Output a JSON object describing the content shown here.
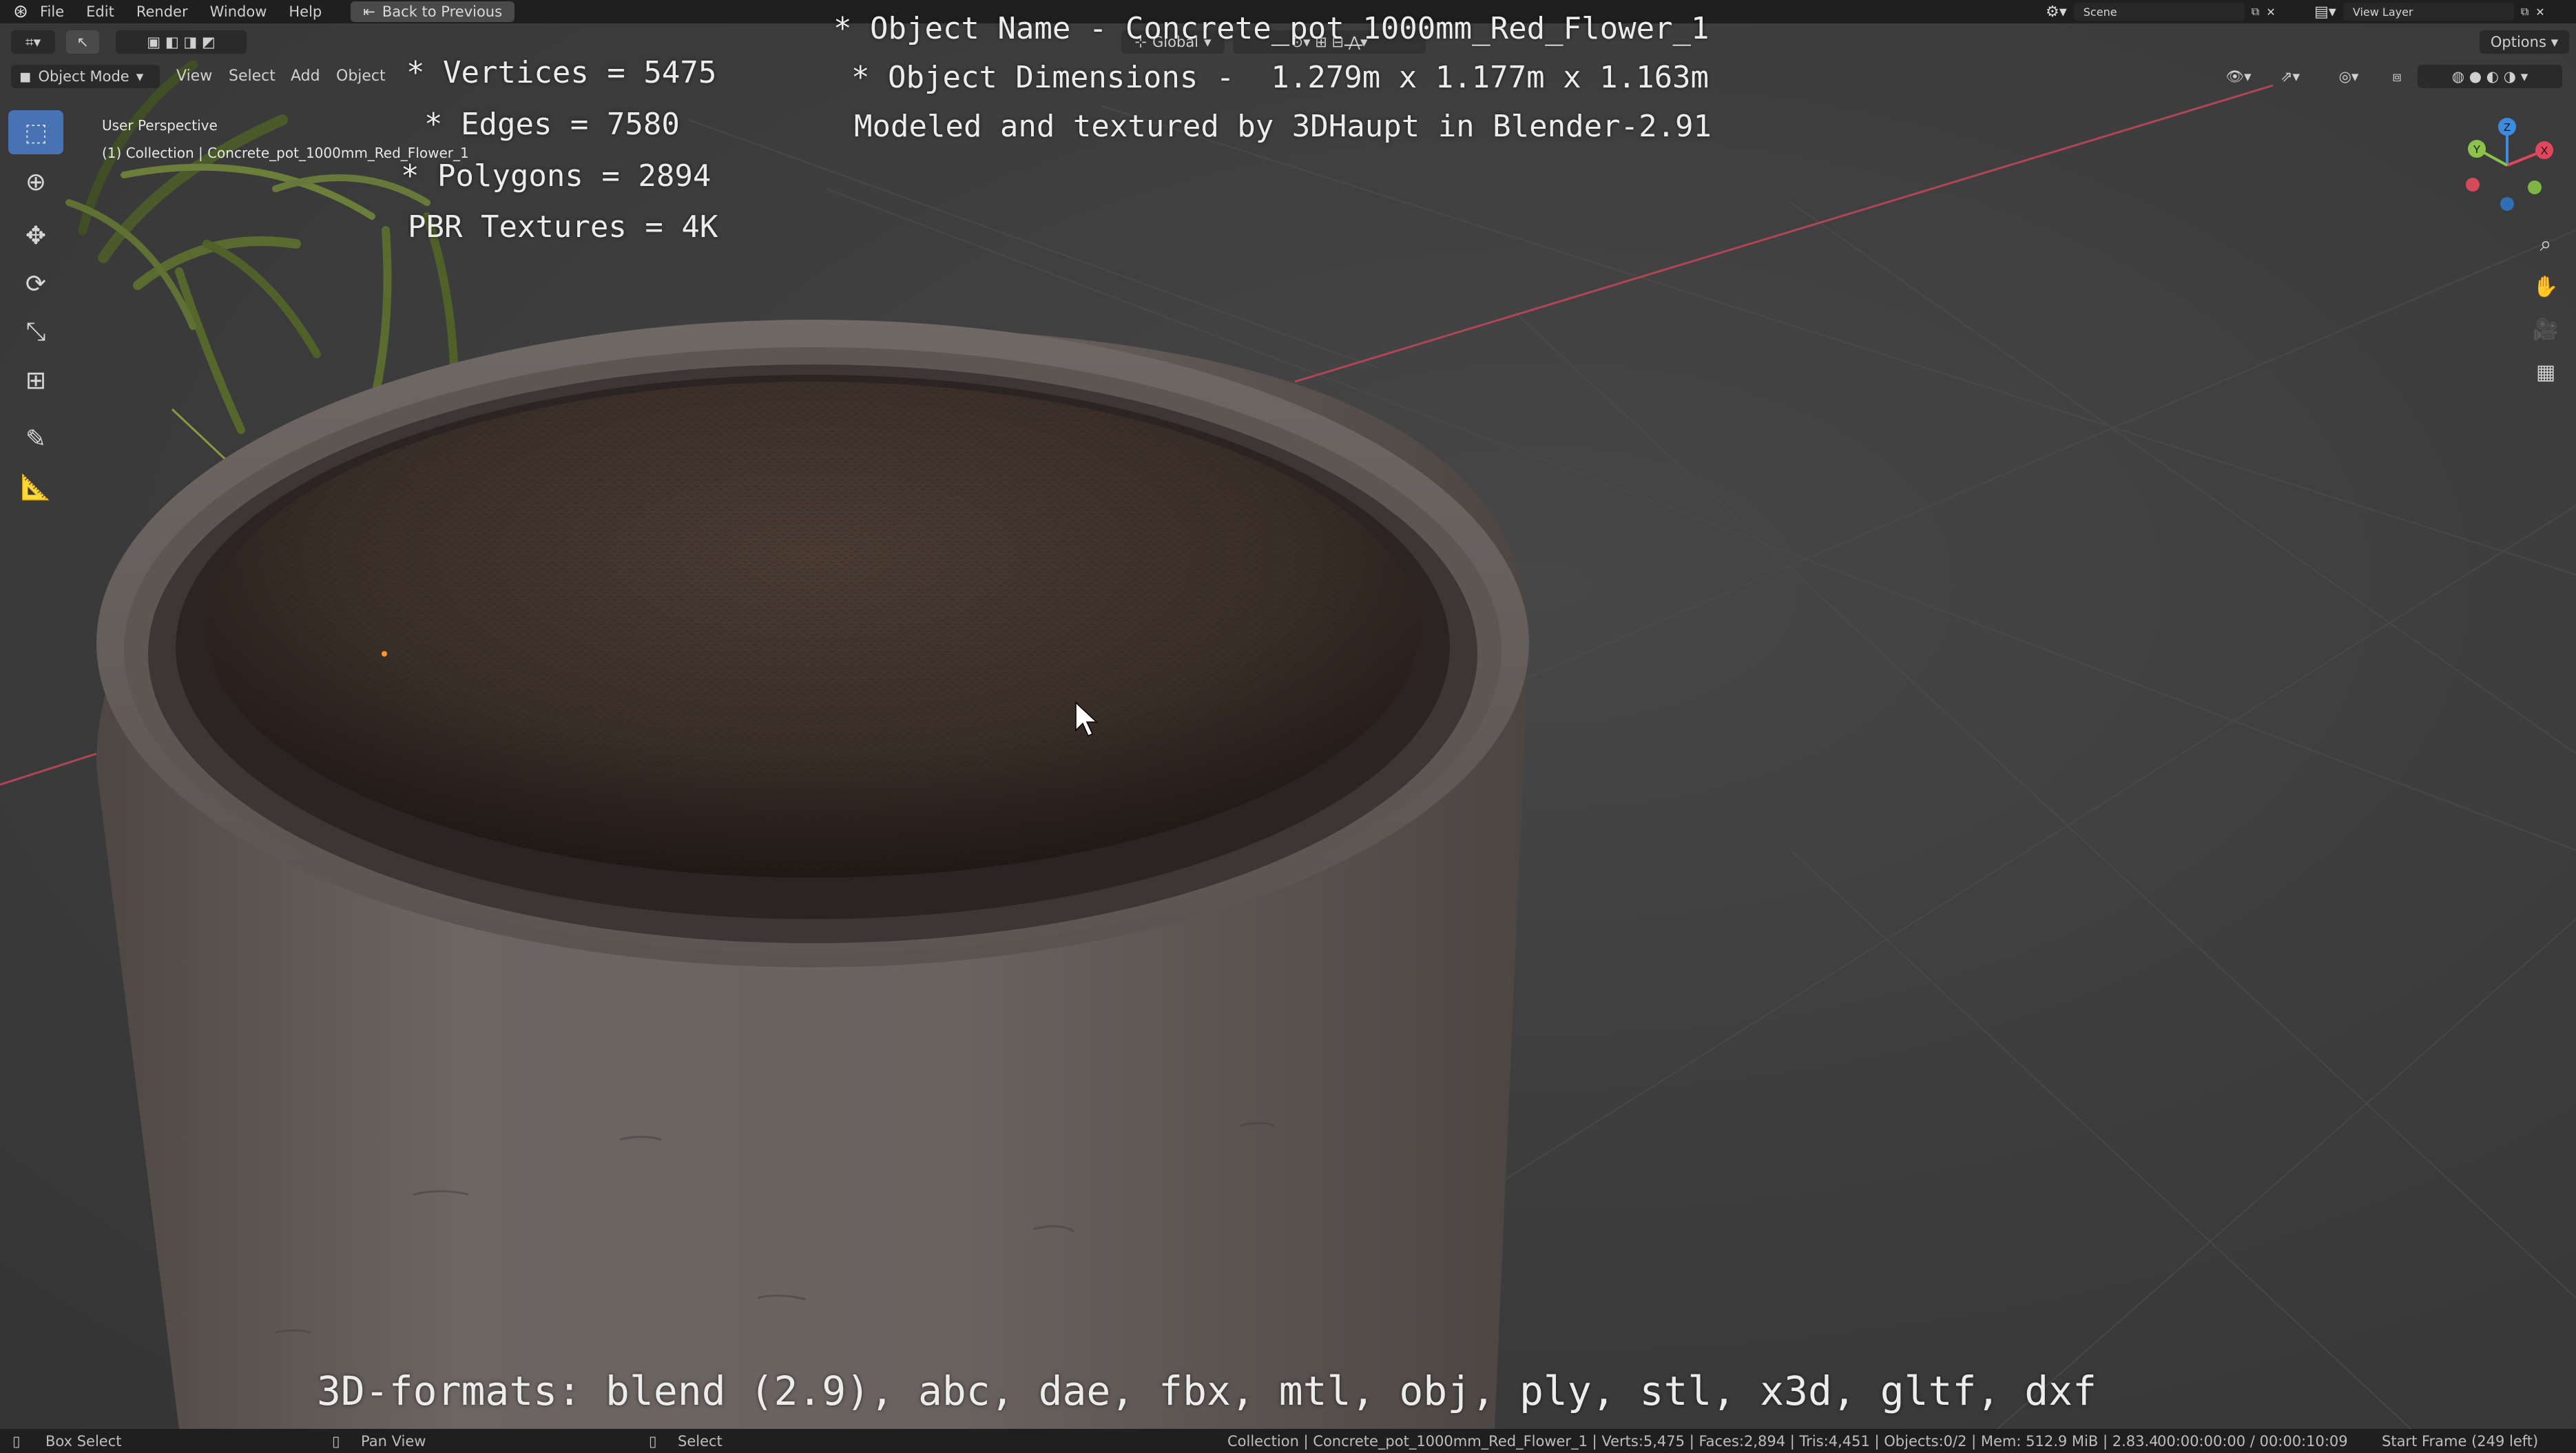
{
  "topbar": {
    "menus": [
      "File",
      "Edit",
      "Render",
      "Window",
      "Help"
    ],
    "back_label": "Back to Previous",
    "scene_label": "Scene",
    "view_layer_label": "View Layer"
  },
  "viewport_header": {
    "mode": "Object Mode",
    "menus": [
      "View",
      "Select",
      "Add",
      "Object"
    ],
    "orientation": "Global",
    "options_label": "Options"
  },
  "viewport_info": {
    "perspective": "User Perspective",
    "collection": "(1) Collection | Concrete_pot_1000mm_Red_Flower_1"
  },
  "overlay": {
    "vertices": "* Vertices = 5475",
    "edges": "* Edges = 7580",
    "polygons": "* Polygons = 2894",
    "textures": "PBR Textures = 4K",
    "object_name": "* Object Name - Concrete_pot_1000mm_Red_Flower_1",
    "dimensions": "* Object Dimensions -  1.279m x 1.177m x 1.163m",
    "credit": "Modeled and textured by 3DHaupt in Blender-2.91",
    "formats": "3D-formats: blend (2.9), abc, dae, fbx, mtl, obj, ply, stl, x3d, gltf, dxf"
  },
  "gizmo": {
    "z": "Z",
    "y": "Y",
    "x": "X"
  },
  "statusbar": {
    "box_select": "Box Select",
    "pan_view": "Pan View",
    "select": "Select",
    "stats": "Collection | Concrete_pot_1000mm_Red_Flower_1 | Verts:5,475 | Faces:2,894 | Tris:4,451 | Objects:0/2 | Mem: 512.9 MiB | 2.83.4",
    "time": "00:00:00:00 / 00:00:10:09",
    "start_frame": "Start Frame (249 left)"
  },
  "colors": {
    "accent": "#4772b3",
    "axis_x": "#e0475a",
    "axis_y": "#8bc34a",
    "axis_z": "#3d8be0",
    "soil": "#3a2e27",
    "concrete": "#6b6360"
  },
  "icons": [
    "blender-logo-icon",
    "select-box-icon",
    "cursor-icon",
    "move-icon",
    "rotate-icon",
    "scale-icon",
    "transform-icon",
    "annotate-icon",
    "measure-icon",
    "zoom-icon",
    "hand-icon",
    "camera-icon",
    "grid-icon"
  ]
}
